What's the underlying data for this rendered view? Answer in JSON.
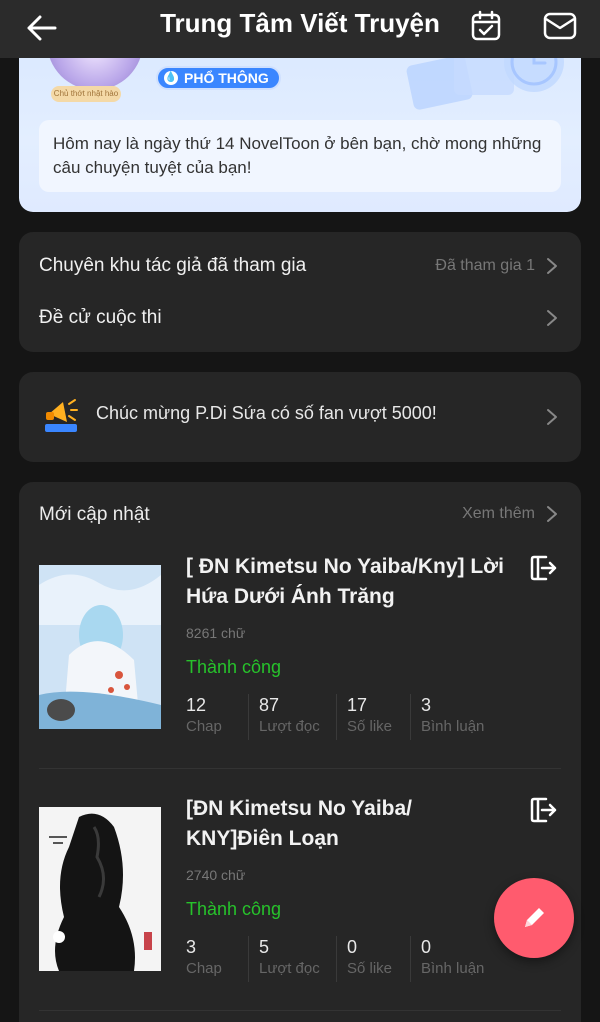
{
  "header": {
    "title": "Trung Tâm Viết Truyện"
  },
  "profile": {
    "avatar_tag": "Chủ thớt nhật hào",
    "level_label": "PHỔ THÔNG",
    "welcome_text": "Hôm nay là ngày thứ 14 NovelToon ở bên bạn, chờ mong những câu chuyện tuyệt của bạn!"
  },
  "menu": {
    "zones_label": "Chuyên khu tác giả đã tham gia",
    "zones_aside": "Đã tham gia 1",
    "contest_label": "Đề cử cuộc thi"
  },
  "announcement": {
    "text": "Chúc mừng P.Di Sứa có số fan vượt 5000!"
  },
  "updates": {
    "title": "Mới cập nhật",
    "more": "Xem thêm",
    "books": [
      {
        "title": "[ ĐN Kimetsu No Yaiba/Kny] Lời Hứa Dưới Ánh Trăng",
        "words": "8261 chữ",
        "status": "Thành công",
        "stats": [
          {
            "num": "12",
            "label": "Chap"
          },
          {
            "num": "87",
            "label": "Lượt đọc"
          },
          {
            "num": "17",
            "label": "Số like"
          },
          {
            "num": "3",
            "label": "Bình luận"
          }
        ]
      },
      {
        "title": "[ĐN Kimetsu No Yaiba/ KNY]Điên Loạn",
        "words": "2740 chữ",
        "status": "Thành công",
        "stats": [
          {
            "num": "3",
            "label": "Chap"
          },
          {
            "num": "5",
            "label": "Lượt đọc"
          },
          {
            "num": "0",
            "label": "Số like"
          },
          {
            "num": "0",
            "label": "Bình luận"
          }
        ]
      }
    ]
  },
  "colors": {
    "accent_green": "#27c22b",
    "fab": "#ff5b6e",
    "badge_blue": "#3a86ff"
  }
}
